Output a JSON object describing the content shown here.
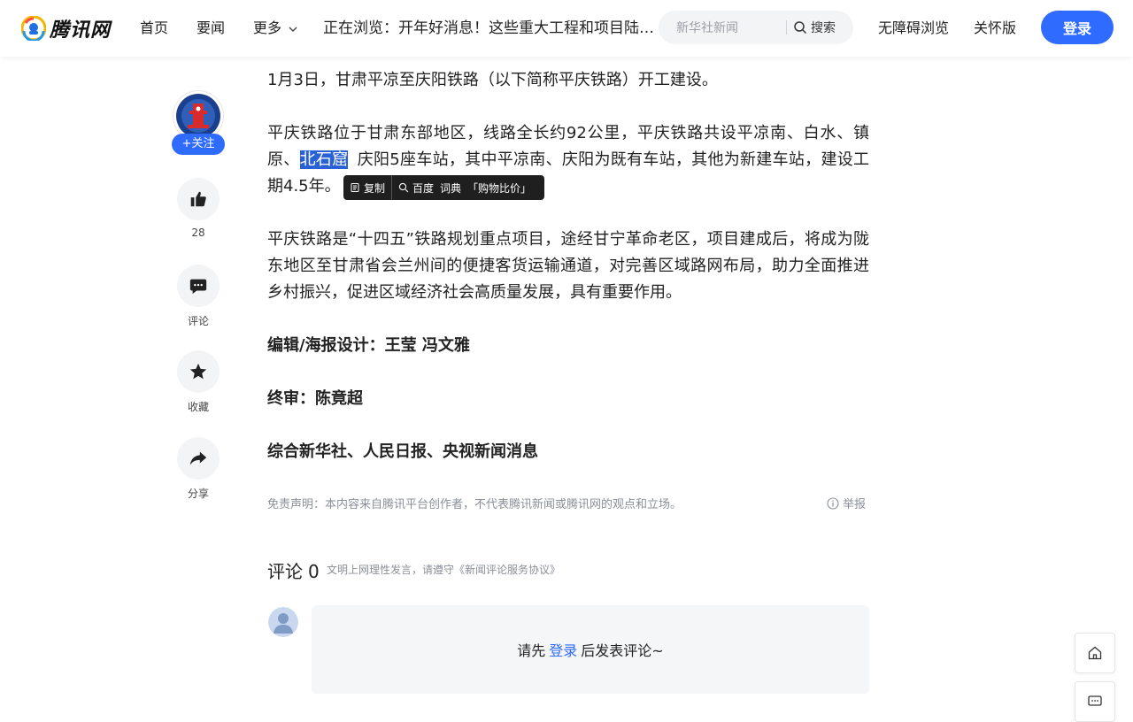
{
  "header": {
    "logo_text": "腾讯网",
    "nav": [
      {
        "label": "首页"
      },
      {
        "label": "要闻"
      },
      {
        "label": "更多"
      }
    ],
    "browsing_text": "正在浏览：开年好消息！这些重大工程和项目陆续开工",
    "search_placeholder": "新华社新闻",
    "search_button": "搜索",
    "accessibility": "无障碍浏览",
    "care_mode": "关怀版",
    "login": "登录"
  },
  "rail": {
    "follow": "+关注",
    "like_count": "28",
    "comment": "评论",
    "favorite": "收藏",
    "share": "分享"
  },
  "article": {
    "p1": "1月3日，甘肃平凉至庆阳铁路（以下简称平庆铁路）开工建设。",
    "p2_before": "平庆铁路位于甘肃东部地区，线路全长约92公里，平庆铁路共设平凉南、白水、镇原、",
    "p2_selected": "北石窟",
    "p2_after": "庆阳5座车站，其中平凉南、庆阳为既有车站，其他为新建车站，建设工期4.5年。",
    "p3": "平庆铁路是“十四五”铁路规划重点项目，途经甘宁革命老区，项目建成后，将成为陇东地区至甘肃省会兰州间的便捷客货运输通道，对完善区域路网布局，助力全面推进乡村振兴，促进区域经济社会高质量发展，具有重要作用。",
    "editor": "编辑/海报设计：王莹 冯文雅",
    "review": "终审：陈竟超",
    "source": "综合新华社、人民日报、央视新闻消息"
  },
  "selection_toolbar": {
    "copy": "复制",
    "baidu": "百度",
    "dict": "词典",
    "shop": "「购物比价」"
  },
  "disclaimer": "免责声明：本内容来自腾讯平台创作者，不代表腾讯新闻或腾讯网的观点和立场。",
  "report": "举报",
  "comments": {
    "title": "评论",
    "count": "0",
    "note": "文明上网理性发言，请遵守《新闻评论服务协议》",
    "prompt_before": "请先",
    "prompt_link": "登录",
    "prompt_after": "后发表评论~"
  },
  "colors": {
    "accent": "#2f6bff",
    "selection": "#2861d6",
    "toolbar": "#1f1f1f"
  }
}
